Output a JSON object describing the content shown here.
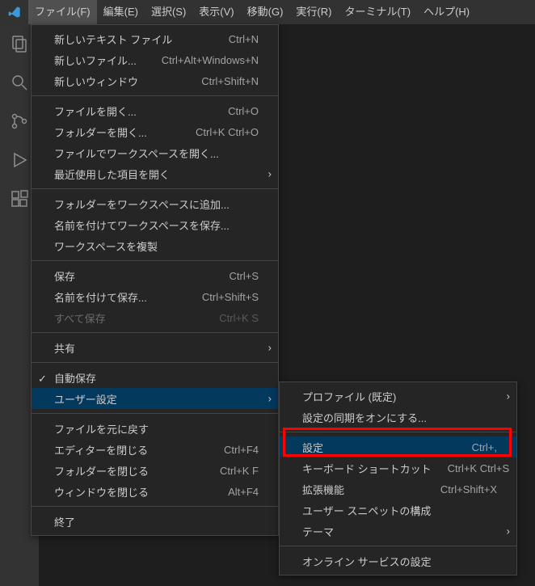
{
  "menubar": {
    "items": [
      {
        "label": "ファイル(F)"
      },
      {
        "label": "編集(E)"
      },
      {
        "label": "選択(S)"
      },
      {
        "label": "表示(V)"
      },
      {
        "label": "移動(G)"
      },
      {
        "label": "実行(R)"
      },
      {
        "label": "ターミナル(T)"
      },
      {
        "label": "ヘルプ(H)"
      }
    ]
  },
  "fileMenu": {
    "newTextFile": {
      "label": "新しいテキスト ファイル",
      "accel": "Ctrl+N"
    },
    "newFile": {
      "label": "新しいファイル...",
      "accel": "Ctrl+Alt+Windows+N"
    },
    "newWindow": {
      "label": "新しいウィンドウ",
      "accel": "Ctrl+Shift+N"
    },
    "openFile": {
      "label": "ファイルを開く...",
      "accel": "Ctrl+O"
    },
    "openFolder": {
      "label": "フォルダーを開く...",
      "accel": "Ctrl+K Ctrl+O"
    },
    "openWorkspace": {
      "label": "ファイルでワークスペースを開く..."
    },
    "openRecent": {
      "label": "最近使用した項目を開く"
    },
    "addFolder": {
      "label": "フォルダーをワークスペースに追加..."
    },
    "saveWorkspace": {
      "label": "名前を付けてワークスペースを保存..."
    },
    "dupWorkspace": {
      "label": "ワークスペースを複製"
    },
    "save": {
      "label": "保存",
      "accel": "Ctrl+S"
    },
    "saveAs": {
      "label": "名前を付けて保存...",
      "accel": "Ctrl+Shift+S"
    },
    "saveAll": {
      "label": "すべて保存",
      "accel": "Ctrl+K S"
    },
    "share": {
      "label": "共有"
    },
    "autoSave": {
      "label": "自動保存"
    },
    "preferences": {
      "label": "ユーザー設定"
    },
    "revert": {
      "label": "ファイルを元に戻す"
    },
    "closeEditor": {
      "label": "エディターを閉じる",
      "accel": "Ctrl+F4"
    },
    "closeFolder": {
      "label": "フォルダーを閉じる",
      "accel": "Ctrl+K F"
    },
    "closeWindow": {
      "label": "ウィンドウを閉じる",
      "accel": "Alt+F4"
    },
    "exit": {
      "label": "終了"
    }
  },
  "prefMenu": {
    "profile": {
      "label": "プロファイル (既定)"
    },
    "sync": {
      "label": "設定の同期をオンにする..."
    },
    "settings": {
      "label": "設定",
      "accel": "Ctrl+,"
    },
    "keyboard": {
      "label": "キーボード ショートカット",
      "accel": "Ctrl+K Ctrl+S"
    },
    "extensions": {
      "label": "拡張機能",
      "accel": "Ctrl+Shift+X"
    },
    "snippets": {
      "label": "ユーザー スニペットの構成"
    },
    "theme": {
      "label": "テーマ"
    },
    "online": {
      "label": "オンライン サービスの設定"
    }
  }
}
